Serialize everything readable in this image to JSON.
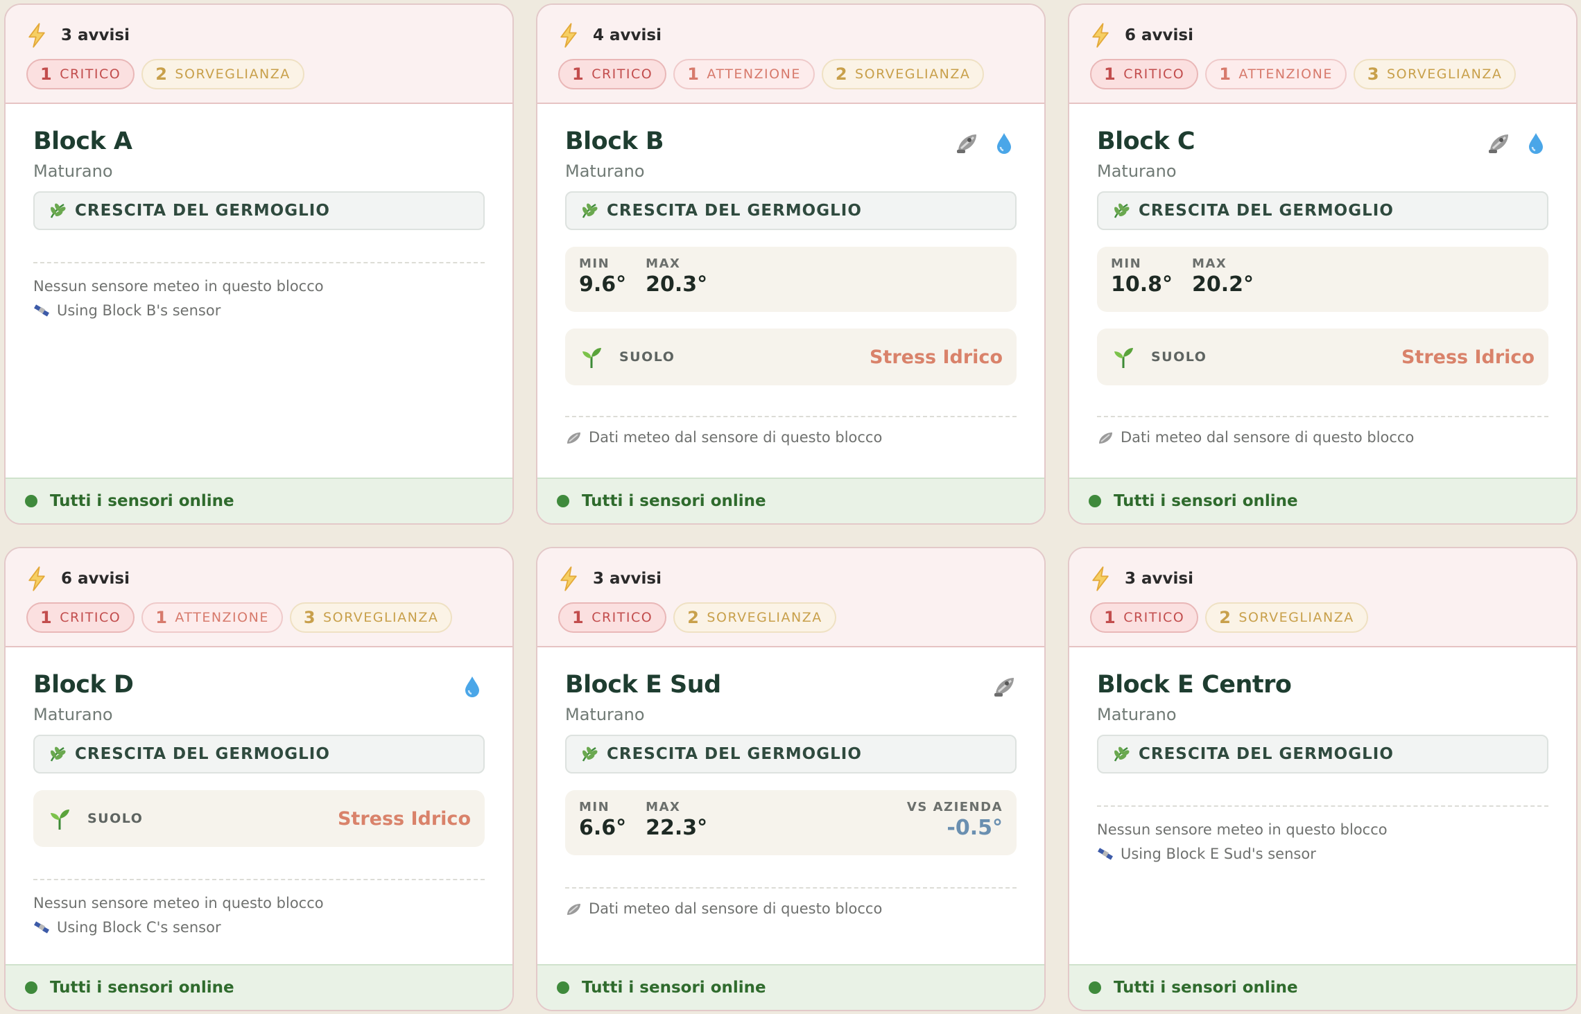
{
  "labels": {
    "critico": "CRITICO",
    "attenzione": "ATTENZIONE",
    "sorveglianza": "SORVEGLIANZA",
    "min": "MIN",
    "max": "MAX",
    "vs_azienda": "VS AZIENDA",
    "suolo": "SUOLO",
    "footer": "Tutti i sensori online",
    "no_sensor": "Nessun sensore meteo in questo blocco",
    "own_sensor": "Dati meteo dal sensore di questo blocco"
  },
  "colors": {
    "accent_green": "#1e3d30",
    "critical": "#c24d4d",
    "attention": "#d77a6c",
    "surveillance": "#c8a04b",
    "online": "#3f8a3c",
    "stress": "#d9826a",
    "delta": "#6a8fb0"
  },
  "blocks": [
    {
      "alerts_title": "3 avvisi",
      "critico": "1",
      "sorveglianza": "2",
      "name": "Block A",
      "variety": "Maturano",
      "stage": "CRESCITA DEL GERMOGLIO",
      "icons": [],
      "using_sensor": "Using Block B's sensor"
    },
    {
      "alerts_title": "4 avvisi",
      "critico": "1",
      "attenzione": "1",
      "sorveglianza": "2",
      "name": "Block B",
      "variety": "Maturano",
      "stage": "CRESCITA DEL GERMOGLIO",
      "icons": [
        "satellite-icon",
        "water-drop-icon"
      ],
      "min": "9.6°",
      "max": "20.3°",
      "soil_status": "Stress Idrico"
    },
    {
      "alerts_title": "6 avvisi",
      "critico": "1",
      "attenzione": "1",
      "sorveglianza": "3",
      "name": "Block C",
      "variety": "Maturano",
      "stage": "CRESCITA DEL GERMOGLIO",
      "icons": [
        "satellite-icon",
        "water-drop-icon"
      ],
      "min": "10.8°",
      "max": "20.2°",
      "soil_status": "Stress Idrico"
    },
    {
      "alerts_title": "6 avvisi",
      "critico": "1",
      "attenzione": "1",
      "sorveglianza": "3",
      "name": "Block D",
      "variety": "Maturano",
      "stage": "CRESCITA DEL GERMOGLIO",
      "icons": [
        "water-drop-icon"
      ],
      "soil_status": "Stress Idrico",
      "using_sensor": "Using Block C's sensor"
    },
    {
      "alerts_title": "3 avvisi",
      "critico": "1",
      "sorveglianza": "2",
      "name": "Block E Sud",
      "variety": "Maturano",
      "stage": "CRESCITA DEL GERMOGLIO",
      "icons": [
        "satellite-icon"
      ],
      "min": "6.6°",
      "max": "22.3°",
      "vs_azienda": "-0.5°"
    },
    {
      "alerts_title": "3 avvisi",
      "critico": "1",
      "sorveglianza": "2",
      "name": "Block E Centro",
      "variety": "Maturano",
      "stage": "CRESCITA DEL GERMOGLIO",
      "icons": [],
      "using_sensor": "Using Block E Sud's sensor"
    }
  ]
}
